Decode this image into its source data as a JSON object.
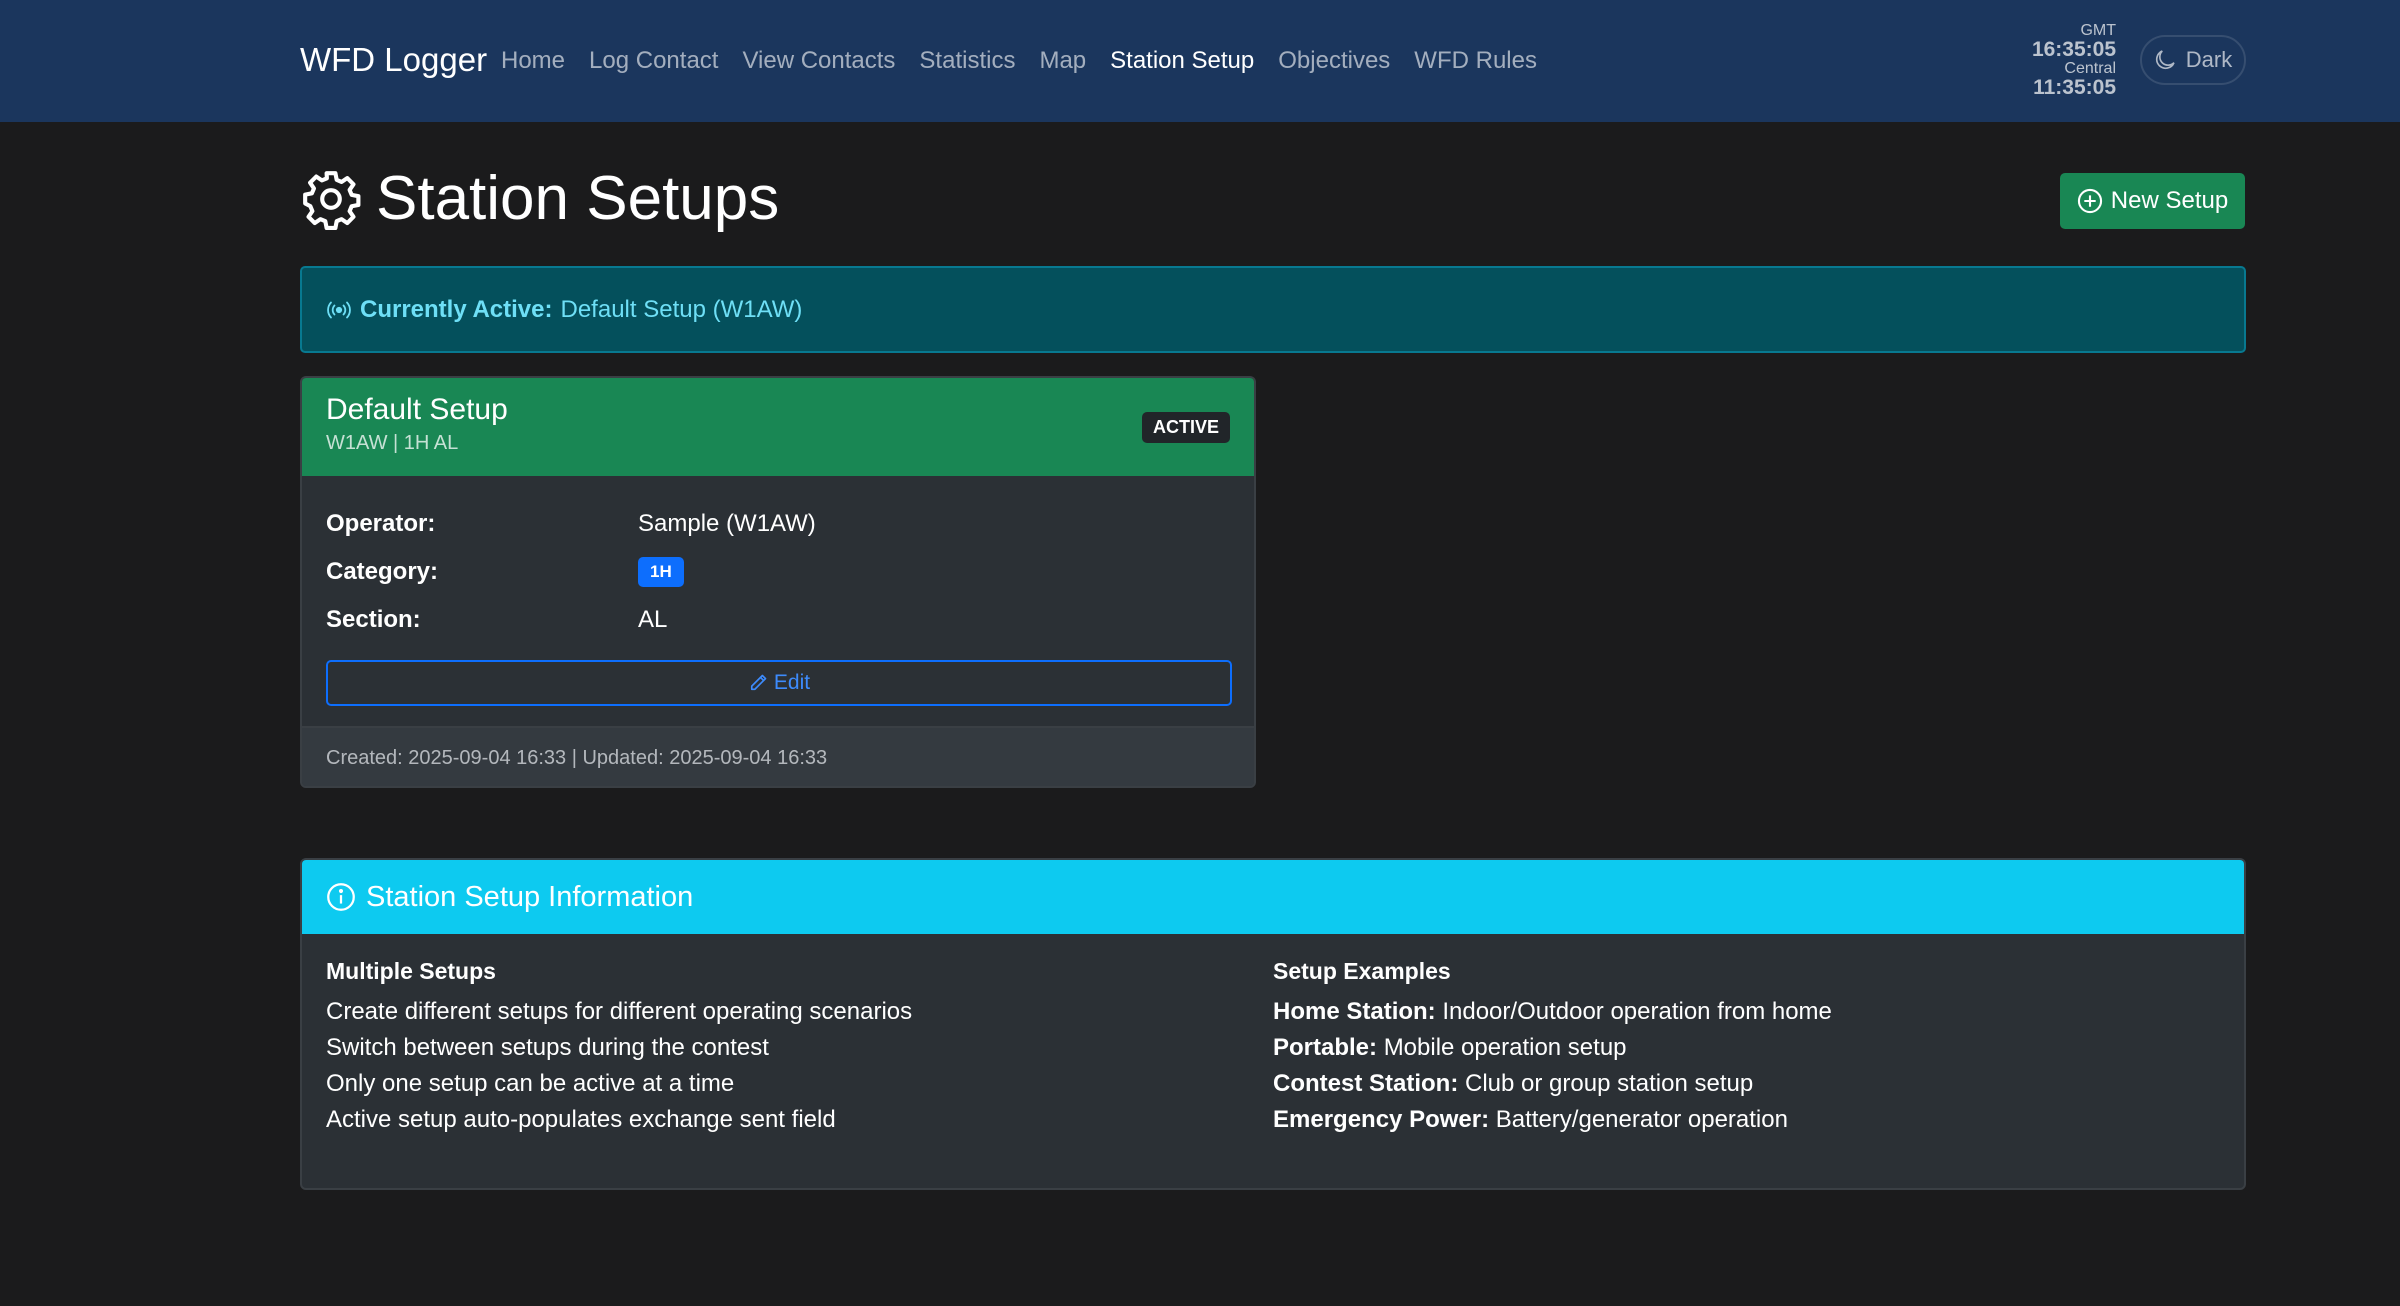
{
  "navbar": {
    "brand": "WFD Logger",
    "links": [
      "Home",
      "Log Contact",
      "View Contacts",
      "Statistics",
      "Map",
      "Station Setup",
      "Objectives",
      "WFD Rules"
    ],
    "active_link": "Station Setup",
    "clock": {
      "gmt_label": "GMT",
      "gmt_time": "16:35:05",
      "local_label": "Central",
      "local_time": "11:35:05"
    },
    "theme_button": "Dark"
  },
  "page": {
    "title": "Station Setups",
    "new_button": "New Setup"
  },
  "active_alert": {
    "label": "Currently Active:",
    "value": "Default Setup (W1AW)"
  },
  "setup_card": {
    "title": "Default Setup",
    "subtitle": "W1AW | 1H AL",
    "badge": "ACTIVE",
    "fields": {
      "operator_label": "Operator:",
      "operator_value": "Sample (W1AW)",
      "category_label": "Category:",
      "category_value": "1H",
      "section_label": "Section:",
      "section_value": "AL"
    },
    "edit_button": "Edit",
    "footer": "Created: 2025-09-04 16:33 | Updated: 2025-09-04 16:33"
  },
  "info_card": {
    "title": "Station Setup Information",
    "left": {
      "heading": "Multiple Setups",
      "items": [
        "Create different setups for different operating scenarios",
        "Switch between setups during the contest",
        "Only one setup can be active at a time",
        "Active setup auto-populates exchange sent field"
      ]
    },
    "right": {
      "heading": "Setup Examples",
      "items": [
        {
          "label": "Home Station:",
          "text": "Indoor/Outdoor operation from home"
        },
        {
          "label": "Portable:",
          "text": "Mobile operation setup"
        },
        {
          "label": "Contest Station:",
          "text": "Club or group station setup"
        },
        {
          "label": "Emergency Power:",
          "text": "Battery/generator operation"
        }
      ]
    }
  },
  "colors": {
    "navbar": "#1b365d",
    "background": "#1b1b1c",
    "success": "#198754",
    "info": "#0dcaf0",
    "alert_bg": "#04505c",
    "primary": "#0d6efd"
  }
}
